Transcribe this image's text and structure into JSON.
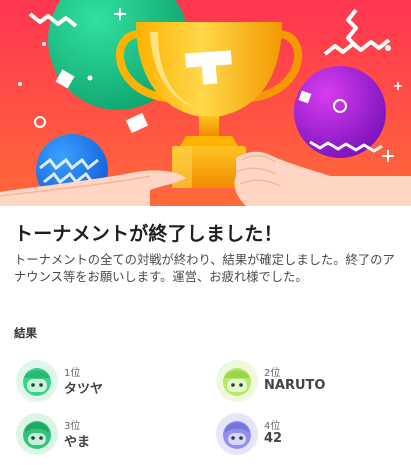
{
  "hero": {
    "alt": "trophy-celebration-illustration",
    "colors": {
      "bg_top": "#ff3a4d",
      "bg_bottom": "#ff6a3c",
      "trophy": "#ffc21a",
      "green_planet": "#19c28a",
      "purple_planet": "#a61ad6",
      "blue_planet": "#1a7ef0"
    }
  },
  "announcement": {
    "title": "トーナメントが終了しました！",
    "body": "トーナメントの全ての対戦が終わり、結果が確定しました。終了のアナウンス等をお願いします。運営、お疲れ様でした。"
  },
  "results": {
    "label": "結果",
    "entries": [
      {
        "rank": "1位",
        "name": "タツヤ",
        "avatar_color": "#3ad38a",
        "avatar_bg": "#dff7ea"
      },
      {
        "rank": "2位",
        "name": "NARUTO",
        "avatar_color": "#b6e86a",
        "avatar_bg": "#eef9dc"
      },
      {
        "rank": "3位",
        "name": "やま",
        "avatar_color": "#32c47a",
        "avatar_bg": "#dcf5e7"
      },
      {
        "rank": "4位",
        "name": "42",
        "avatar_color": "#8f8ff0",
        "avatar_bg": "#e6e6fb"
      }
    ]
  }
}
